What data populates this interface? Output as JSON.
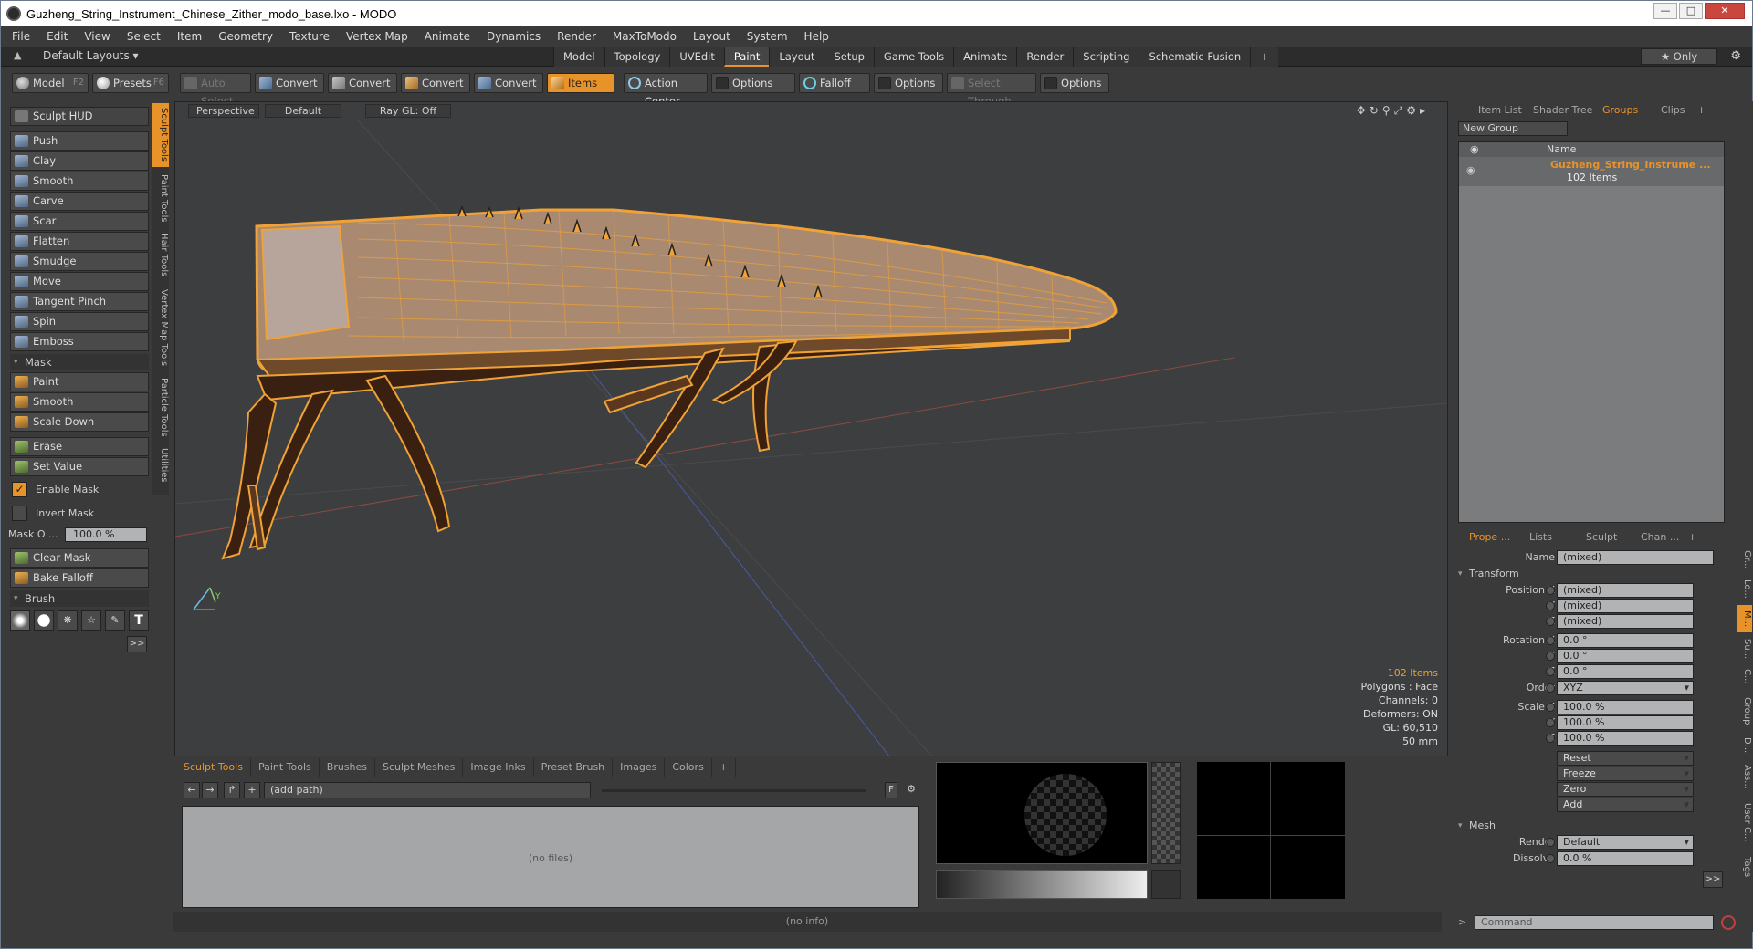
{
  "window": {
    "title": "Guzheng_String_Instrument_Chinese_Zither_modo_base.lxo - MODO",
    "controls": [
      "—",
      "□",
      "✕"
    ]
  },
  "menu": [
    "File",
    "Edit",
    "View",
    "Select",
    "Item",
    "Geometry",
    "Texture",
    "Vertex Map",
    "Animate",
    "Dynamics",
    "Render",
    "MaxToModo",
    "Layout",
    "System",
    "Help"
  ],
  "layoutbar": {
    "layouts_label": "Default Layouts ▾",
    "tabs": [
      "Model",
      "Topology",
      "UVEdit",
      "Paint",
      "Layout",
      "Setup",
      "Game Tools",
      "Animate",
      "Render",
      "Scripting",
      "Schematic Fusion",
      "+"
    ],
    "active_tab": "Paint",
    "only_label": "★ Only",
    "gear": "⚙"
  },
  "toolbar": {
    "model": "Model",
    "model_key": "F2",
    "presets": "Presets",
    "presets_key": "F6",
    "auto_select": "Auto Select",
    "convert1": "Convert",
    "convert2": "Convert",
    "convert3": "Convert",
    "convert4": "Convert",
    "items": "Items",
    "action_center": "Action Center",
    "options1": "Options",
    "falloff": "Falloff",
    "options2": "Options",
    "select_through": "Select Through",
    "options3": "Options"
  },
  "sculpt": {
    "hud": "Sculpt HUD",
    "tools": [
      "Push",
      "Clay",
      "Smooth",
      "Carve",
      "Scar",
      "Flatten",
      "Smudge",
      "Move",
      "Tangent Pinch",
      "Spin",
      "Emboss"
    ],
    "mask_header": "Mask",
    "mask_tools": [
      "Paint",
      "Smooth",
      "Scale Down"
    ],
    "erase": "Erase",
    "set_value": "Set Value",
    "enable_mask": "Enable Mask",
    "invert_mask": "Invert Mask",
    "mask_opacity_label": "Mask O ...",
    "mask_opacity_value": "100.0 %",
    "clear_mask": "Clear Mask",
    "bake_falloff": "Bake Falloff",
    "brush_header": "Brush",
    "more": ">>"
  },
  "side_tabs": [
    "Sculpt Tools",
    "Paint Tools",
    "Hair Tools",
    "Vertex Map Tools",
    "Particle Tools",
    "Utilities"
  ],
  "viewport": {
    "view": "Perspective",
    "shading": "Default",
    "raygl": "Ray GL: Off",
    "stats": {
      "items": "102 Items",
      "polygons": "Polygons : Face",
      "channels": "Channels: 0",
      "deformers": "Deformers: ON",
      "gl": "GL: 60,510",
      "lens": "50 mm"
    }
  },
  "bottom_panel": {
    "tabs": [
      "Sculpt Tools",
      "Paint Tools",
      "Brushes",
      "Sculpt Meshes",
      "Image Inks",
      "Preset Brush",
      "Images",
      "Colors",
      "+"
    ],
    "active_tab": "Sculpt Tools",
    "path_placeholder": "(add path)",
    "files": "(no files)",
    "f_label": "F"
  },
  "info": "(no info)",
  "right_panel": {
    "tabs": [
      "Item List",
      "Shader Tree",
      "Groups",
      "Clips",
      "+"
    ],
    "active_tab": "Groups",
    "new_group": "New Group",
    "col_name": "Name",
    "group_name": "Guzheng_String_Instrume ...",
    "group_count": "102 Items",
    "prop_tabs": [
      "Prope ...",
      "Lists",
      "Sculpt",
      "Chan ...",
      "+"
    ],
    "active_prop_tab": "Prope ...",
    "name_label": "Name",
    "name_value": "(mixed)",
    "transform_header": "Transform",
    "position_x_label": "Position X",
    "position_x": "(mixed)",
    "position_y": "(mixed)",
    "position_z": "(mixed)",
    "rotation_x_label": "Rotation X",
    "rotation_x": "0.0 °",
    "rotation_y": "0.0 °",
    "rotation_z": "0.0 °",
    "order_label": "Order",
    "order_value": "XYZ",
    "scale_x_label": "Scale X",
    "scale_x": "100.0 %",
    "scale_y": "100.0 %",
    "scale_z": "100.0 %",
    "y_label": "Y",
    "z_label": "Z",
    "reset": "Reset",
    "freeze": "Freeze",
    "zero": "Zero",
    "add": "Add",
    "mesh_header": "Mesh",
    "render_label": "Render",
    "render_value": "Default",
    "dissolve_label": "Dissolve",
    "dissolve_value": "0.0 %",
    "more": ">>",
    "vtabs": [
      "Gr...",
      "Lo...",
      "M...",
      "Su...",
      "C...",
      "Group",
      "D...",
      "Ass...",
      "User C...",
      "Tags"
    ],
    "command_placeholder": "Command"
  },
  "colors": {
    "accent": "#e8932a",
    "wire": "#f0a236",
    "viewport_bg": "#3d3e40"
  }
}
